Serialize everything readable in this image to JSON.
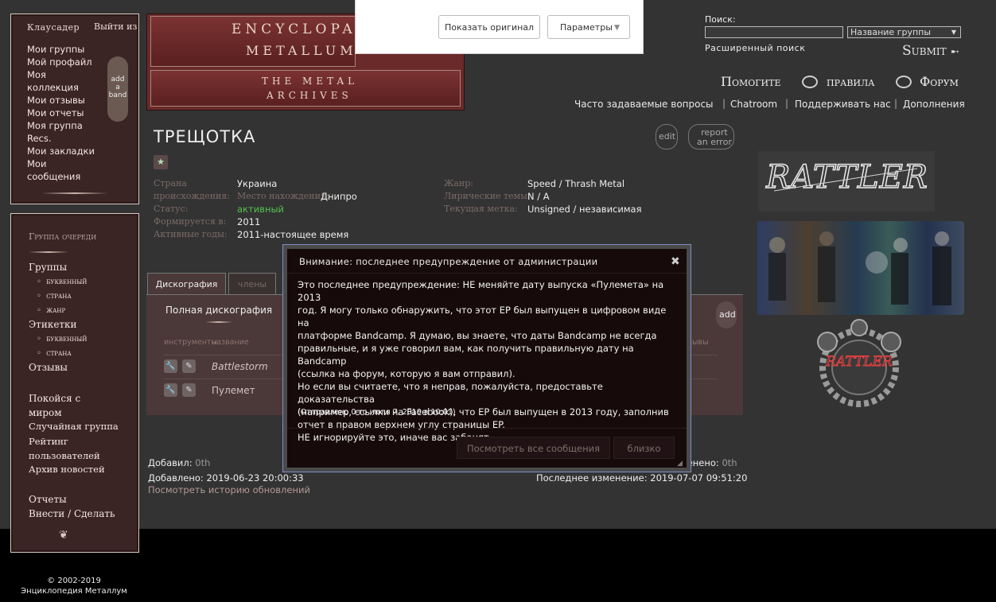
{
  "translate": {
    "show_original": "Показать оригинал",
    "params": "Параметры"
  },
  "user_panel": {
    "title": "Клаусадер",
    "logout": "Выйти из",
    "items": [
      "Мои группы",
      "Мой профайл",
      "Моя коллекция",
      "Мои отзывы",
      "Мои отчеты",
      "Моя группа",
      "Recs.",
      "Мои закладки",
      "Мои сообщения"
    ],
    "add_band": [
      "add",
      "a",
      "band"
    ]
  },
  "nav_panel": {
    "queue": "Группа очереди",
    "bands": "Группы",
    "bands_sub": [
      "буквенный",
      "страна",
      "жанр"
    ],
    "labels": "Этикетки",
    "labels_sub": [
      "буквенный",
      "страна"
    ],
    "reviews": "Отзывы",
    "rip": "Покойся с миром",
    "random": "Случайная группа",
    "rating": "Рейтинг пользователей",
    "news": "Архив новостей",
    "reports": "Отчеты",
    "submit": "Внести / Сделать"
  },
  "banner": {
    "line1": "ENCYCLOPAED",
    "line2": "METALLUM",
    "line3": "THE METAL",
    "line4": "ARCHIVES"
  },
  "search": {
    "label": "Поиск:",
    "select": "Название группы",
    "advanced": "Расширенный поиск",
    "submit": "Submit"
  },
  "topnav": {
    "help": "Помогите",
    "rules": "правила",
    "forum": "Форум"
  },
  "subnav": [
    "Часто задаваемые вопросы",
    "Chatroom",
    "Поддерживать нас",
    "Дополнения"
  ],
  "band": {
    "name": "ТРЕЩОТКА",
    "edit": "edit",
    "report": "report",
    "an_error": "an error",
    "country_label": "Страна",
    "origin_label": "происхождения:",
    "country": "Украина",
    "location_label": "Место нахождения:",
    "location": "Днипро",
    "status_label": "Статус:",
    "status": "активный",
    "formed_label": "Формируется в:",
    "formed": "2011",
    "years_label": "Активные годы:",
    "years": "2011-настоящее время",
    "genre_label": "Жанр:",
    "genre": "Speed / Thrash Metal",
    "themes_label": "Лирические темы:",
    "themes": "N / A",
    "label_label": "Текущая метка:",
    "label": "Unsigned / независимая"
  },
  "tabs": [
    "Дискография",
    "члены"
  ],
  "discography": {
    "full": "Полная дискография",
    "add": "add",
    "col_tools": "инструменты",
    "col_name": "название",
    "col_right": "ывы",
    "rows": [
      "Battlestorm",
      "Пулемет"
    ]
  },
  "modal": {
    "title": "Внимание: последнее предупреждение от администрации",
    "close": "✖",
    "lines": [
      "Это последнее предупреждение: НЕ меняйте дату выпуска «Пулемета» на 2013",
      "год. Я могу только обнаружить, что этот EP был выпущен в цифровом виде на",
      "платформе Bandcamp. Я думаю, вы знаете, что даты Bandcamp не всегда",
      "правильные, и я уже говорил вам, как получить правильную дату на Bandcamp",
      "(ссылка на форум, которую я вам отправил).",
      "Но если вы считаете, что я неправ, пожалуйста, предоставьте доказательства",
      "(например, ссылки на Facebook), что EP был выпущен в 2013 году, заполнив",
      "отчет в правом верхнем углу страницы EP.",
      "НЕ игнорируйте это, иначе вас забанят."
    ],
    "signature": "(Отправлено 0-го июля 7, 2019 в 10:01)",
    "view_all": "Посмотреть все сообщения",
    "close_btn": "близко"
  },
  "meta": {
    "added_by_label": "Добавил:",
    "added_by": "0th",
    "modified_by_suffix": "менено:",
    "modified_by": "0th",
    "added_label": "Добавлено:",
    "added": "2019-06-23 20:00:33",
    "modified_label": "Последнее изменение:",
    "modified": "2019-07-07 09:51:20",
    "history": "Посмотреть историю обновлений"
  },
  "logo": {
    "text": "RATTLER"
  },
  "footer": {
    "copyright": "© 2002-2019",
    "name": "Энциклопедия Металлум"
  }
}
